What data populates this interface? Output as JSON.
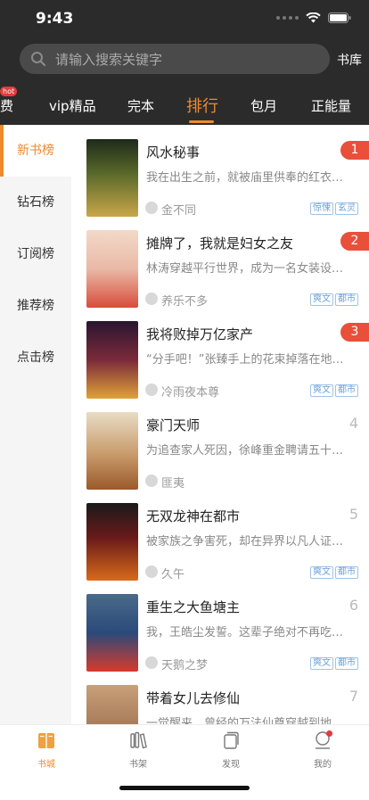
{
  "status": {
    "time": "9:43"
  },
  "search": {
    "placeholder": "请输入搜索关键字",
    "library_label": "书库"
  },
  "tabs": [
    {
      "label": "费",
      "badge": "hot"
    },
    {
      "label": "vip精品"
    },
    {
      "label": "完本"
    },
    {
      "label": "排行",
      "active": true
    },
    {
      "label": "包月"
    },
    {
      "label": "正能量"
    }
  ],
  "sidebar": {
    "items": [
      {
        "label": "新书榜",
        "active": true
      },
      {
        "label": "钻石榜"
      },
      {
        "label": "订阅榜"
      },
      {
        "label": "推荐榜"
      },
      {
        "label": "点击榜"
      }
    ]
  },
  "books": [
    {
      "rank": "1",
      "title": "风水秘事",
      "desc": "我在出生之前，就被庙里供奉的红衣娘娘看中了……",
      "author": "金不同",
      "tags": [
        "惊悚",
        "玄灵"
      ]
    },
    {
      "rank": "2",
      "title": "摊牌了，我就是妇女之友",
      "desc": "林涛穿越平行世界，成为一名女装设计师……",
      "author": "养乐不多",
      "tags": [
        "爽文",
        "都市"
      ]
    },
    {
      "rank": "3",
      "title": "我将败掉万亿家产",
      "desc": "“分手吧！”张臻手上的花束掉落在地上……",
      "author": "冷雨夜本尊",
      "tags": [
        "爽文",
        "都市"
      ]
    },
    {
      "rank": "4",
      "title": "豪门天师",
      "desc": "为追查家人死因，徐峰重金聘请五十名道士……",
      "author": "匪夷",
      "tags": []
    },
    {
      "rank": "5",
      "title": "无双龙神在都市",
      "desc": "被家族之争害死，却在异界以凡人证道……",
      "author": "久午",
      "tags": [
        "爽文",
        "都市"
      ]
    },
    {
      "rank": "6",
      "title": "重生之大鱼塘主",
      "desc": "我，王皓尘发誓。这辈子绝对不再吃软饭……",
      "author": "天鹅之梦",
      "tags": [
        "爽文",
        "都市"
      ]
    },
    {
      "rank": "7",
      "title": "带着女儿去修仙",
      "desc": "一觉醒来，曾经的万法仙尊穿越到地球……",
      "author": "",
      "tags": []
    }
  ],
  "bottom_nav": [
    {
      "label": "书城",
      "icon": "book-city-icon",
      "active": true
    },
    {
      "label": "书架",
      "icon": "bookshelf-icon"
    },
    {
      "label": "发现",
      "icon": "discover-icon"
    },
    {
      "label": "我的",
      "icon": "profile-icon"
    }
  ],
  "colors": {
    "accent": "#ee8a2c",
    "rank_badge": "#e8503a",
    "tag": "#6aa0d8"
  }
}
